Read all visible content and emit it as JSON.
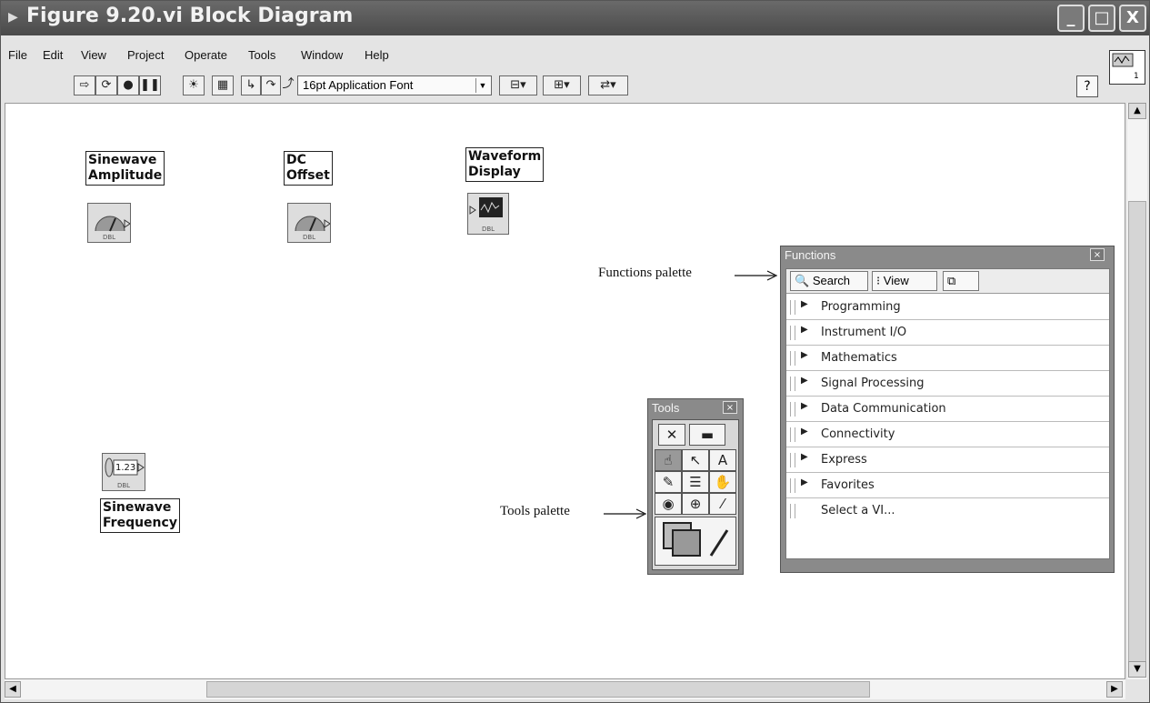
{
  "window": {
    "title": "Figure 9.20.vi Block Diagram",
    "minimize_label": "_",
    "maximize_label": "□",
    "close_label": "X"
  },
  "menu": {
    "items": [
      "File",
      "Edit",
      "View",
      "Project",
      "Operate",
      "Tools",
      "Window",
      "Help"
    ]
  },
  "toolbar": {
    "font": "16pt Application Font",
    "help_label": "?"
  },
  "diagram": {
    "controls": [
      {
        "label_line1": "Sinewave",
        "label_line2": "Amplitude",
        "type": "DBL"
      },
      {
        "label_line1": "DC",
        "label_line2": "Offset",
        "type": "DBL"
      },
      {
        "label_line1": "Waveform",
        "label_line2": "Display",
        "type": "DBL"
      },
      {
        "label_line1": "Sinewave",
        "label_line2": "Frequency",
        "type": "DBL",
        "value_glyph": "1.23"
      }
    ]
  },
  "callouts": {
    "functions": "Functions palette",
    "tools": "Tools palette"
  },
  "functions_palette": {
    "title": "Functions",
    "close_label": "×",
    "search_label": "Search",
    "view_label": "View",
    "categories": [
      "Programming",
      "Instrument I/O",
      "Mathematics",
      "Signal Processing",
      "Data Communication",
      "Connectivity",
      "Express",
      "Favorites"
    ],
    "select_vi": "Select a VI..."
  },
  "tools_palette": {
    "title": "Tools",
    "close_label": "×"
  }
}
